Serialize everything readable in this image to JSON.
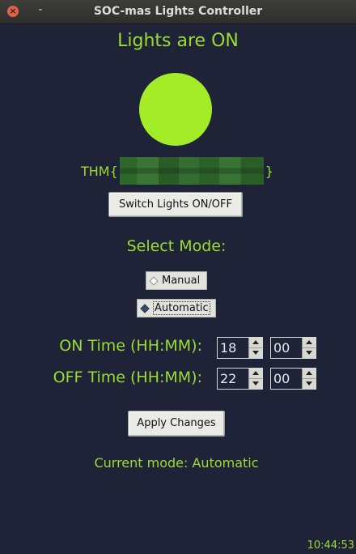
{
  "window": {
    "title": "SOC-mas Lights Controller",
    "close_glyph": "×",
    "minimize_glyph": "-"
  },
  "status": {
    "title": "Lights are ON",
    "lamp_color": "#a4ec28"
  },
  "flag": {
    "prefix": "THM{",
    "suffix": "}"
  },
  "buttons": {
    "switch_label": "Switch Lights ON/OFF",
    "apply_label": "Apply Changes"
  },
  "mode": {
    "heading": "Select Mode:",
    "options": [
      {
        "label": "Manual",
        "selected": false
      },
      {
        "label": "Automatic",
        "selected": true
      }
    ]
  },
  "schedule": {
    "on_label": "ON Time (HH:MM):",
    "on_hour": "18",
    "on_minute": "00",
    "off_label": "OFF Time (HH:MM):",
    "off_hour": "22",
    "off_minute": "00"
  },
  "current_mode_text": "Current mode: Automatic",
  "clock": "10:44:53",
  "colors": {
    "background": "#1f2338",
    "accent": "#9bdc32"
  }
}
